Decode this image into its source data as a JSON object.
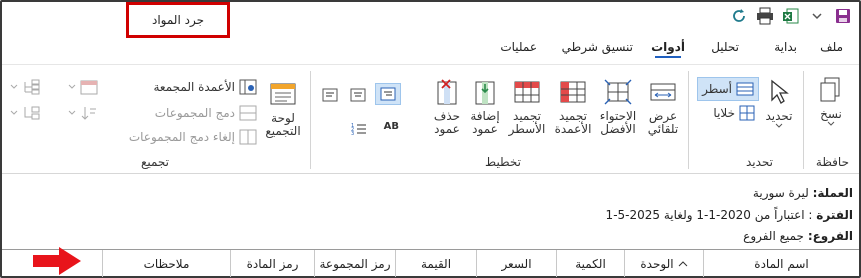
{
  "window": {
    "title": "جرد المواد"
  },
  "qat": {
    "icons": [
      "save-icon",
      "dropdown-icon",
      "excel-export-icon",
      "print-icon",
      "refresh-icon"
    ]
  },
  "tabs": [
    {
      "id": "file",
      "label": "ملف"
    },
    {
      "id": "start",
      "label": "بداية"
    },
    {
      "id": "analysis",
      "label": "تحليل"
    },
    {
      "id": "tools",
      "label": "أدوات",
      "active": true
    },
    {
      "id": "conditional",
      "label": "تنسيق شرطي"
    },
    {
      "id": "operations",
      "label": "عمليات"
    }
  ],
  "ribbon": {
    "save_group": {
      "label": "حافظة",
      "copy": "نسخ"
    },
    "select_group": {
      "label": "تحديد",
      "select": "تحديد",
      "rows": "أسطر",
      "cells": "خلايا"
    },
    "layout_group": {
      "label": "تخطيط",
      "autofit": "عرض تلقائي",
      "fit_best": "الاحتواء الأفضل",
      "freeze_cols": "تجميد الأعمدة",
      "freeze_rows": "تجميد الأسطر",
      "add_col": "إضافة عمود",
      "del_col": "حذف عمود",
      "ab_label": "AB"
    },
    "group_group": {
      "label": "تجميع",
      "board": "لوحة التجميع",
      "grouped_cols": "الأعمدة المجمعة",
      "merge_groups": "دمج المجموعات",
      "unmerge_groups": "إلغاء دمج المجموعات"
    }
  },
  "info": {
    "currency_label": "العملة:",
    "currency_value": "ليرة سورية",
    "period_label": "الفترة",
    "period_value": ": اعتباراً من 2020-1-1 ولغاية 2025-5-1",
    "branches_label": "الفروع:",
    "branches_value": "جميع الفروع"
  },
  "columns": [
    {
      "label": "اسم المادة"
    },
    {
      "label": "الوحدة",
      "sort": "asc"
    },
    {
      "label": "الكمية"
    },
    {
      "label": "السعر"
    },
    {
      "label": "القيمة"
    },
    {
      "label": "رمز المجموعة"
    },
    {
      "label": "رمز المادة"
    },
    {
      "label": "ملاحظات"
    }
  ],
  "colors": {
    "accent": "#1f5fbf",
    "highlight_red": "#d00000",
    "arrow_red": "#e8141b"
  }
}
